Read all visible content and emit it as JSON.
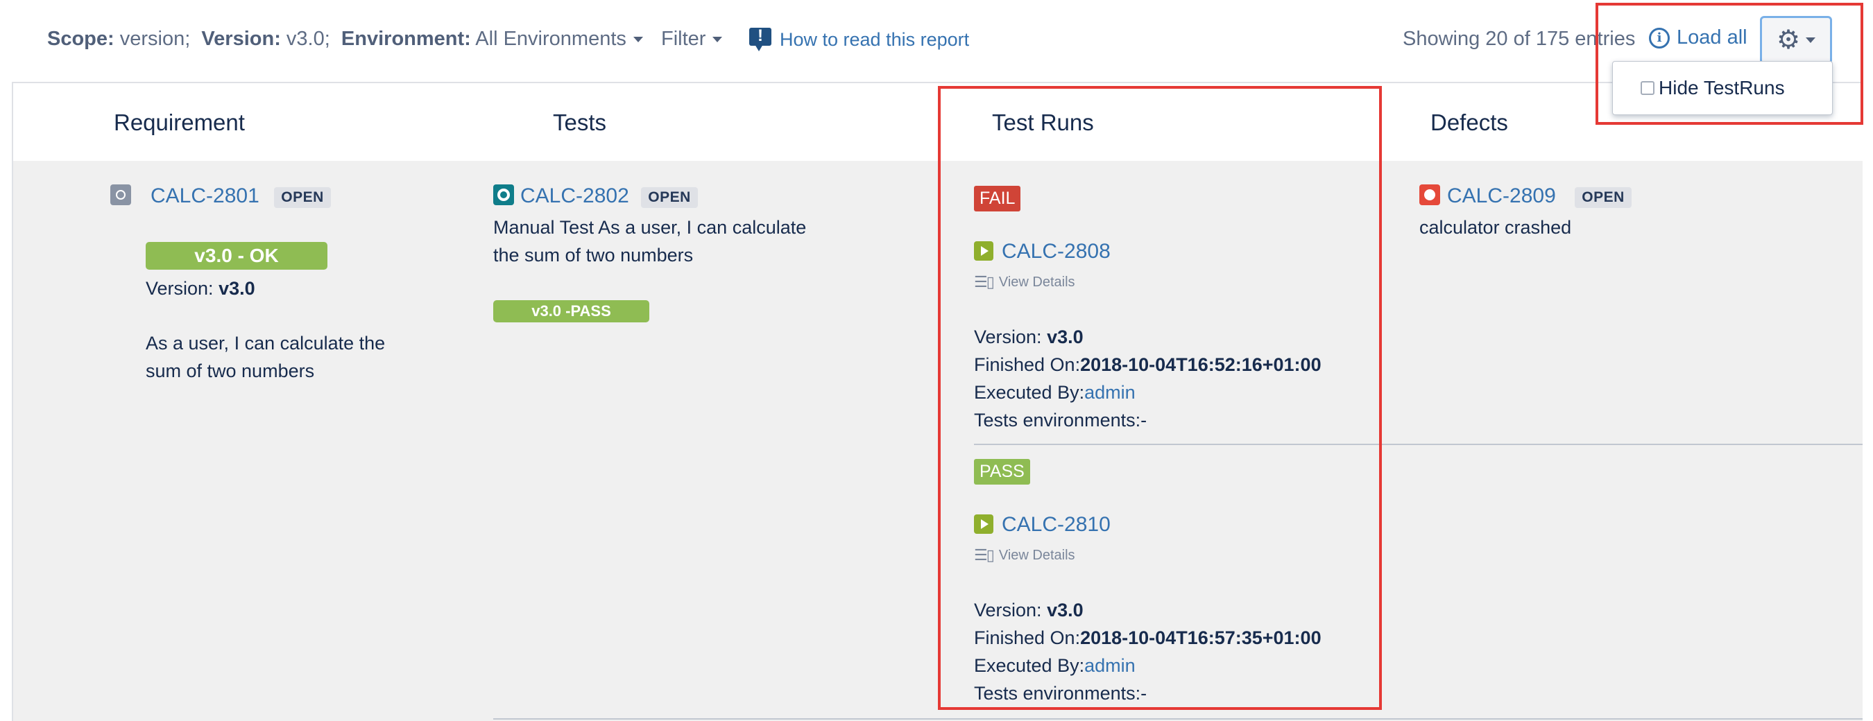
{
  "toolbar": {
    "scope_label": "Scope:",
    "scope_value": "version;",
    "version_label": "Version:",
    "version_value": "v3.0;",
    "environment_label": "Environment:",
    "environment_value": "All Environments",
    "filter_label": "Filter",
    "how_to_read": "How to read this report",
    "showing": "Showing 20 of 175 entries",
    "load_all": "Load all",
    "settings_icon": "gear-icon"
  },
  "settings_menu": {
    "hide_testruns_label": "Hide TestRuns",
    "hide_testruns_checked": false
  },
  "columns": {
    "requirement": "Requirement",
    "tests": "Tests",
    "test_runs": "Test Runs",
    "defects": "Defects"
  },
  "requirement": {
    "key": "CALC-2801",
    "status": "OPEN",
    "coverage_badge": "v3.0 - OK",
    "version_label": "Version: ",
    "version_value": "v3.0",
    "summary_line1": "As a user, I can calculate the",
    "summary_line2": "sum of two numbers"
  },
  "test": {
    "key": "CALC-2802",
    "status": "OPEN",
    "summary_line1": "Manual Test As a user, I can calculate",
    "summary_line2": "the sum of two numbers",
    "result_badge": "v3.0 -PASS"
  },
  "test_runs": [
    {
      "status": "FAIL",
      "key": "CALC-2808",
      "view_details": "View Details",
      "version_label": "Version: ",
      "version_value": "v3.0",
      "finished_label": "Finished On:",
      "finished_value": "2018-10-04T16:52:16+01:00",
      "executed_label": "Executed By:",
      "executed_value": "admin",
      "environments": "Tests environments:-"
    },
    {
      "status": "PASS",
      "key": "CALC-2810",
      "view_details": "View Details",
      "version_label": "Version: ",
      "version_value": "v3.0",
      "finished_label": "Finished On:",
      "finished_value": "2018-10-04T16:57:35+01:00",
      "executed_label": "Executed By:",
      "executed_value": "admin",
      "environments": "Tests environments:-"
    }
  ],
  "defect": {
    "key": "CALC-2809",
    "status": "OPEN",
    "summary": "calculator crashed"
  },
  "colors": {
    "link": "#3572b0",
    "fail": "#d04437",
    "pass": "#8fbc53",
    "highlight_box": "#e53935"
  }
}
